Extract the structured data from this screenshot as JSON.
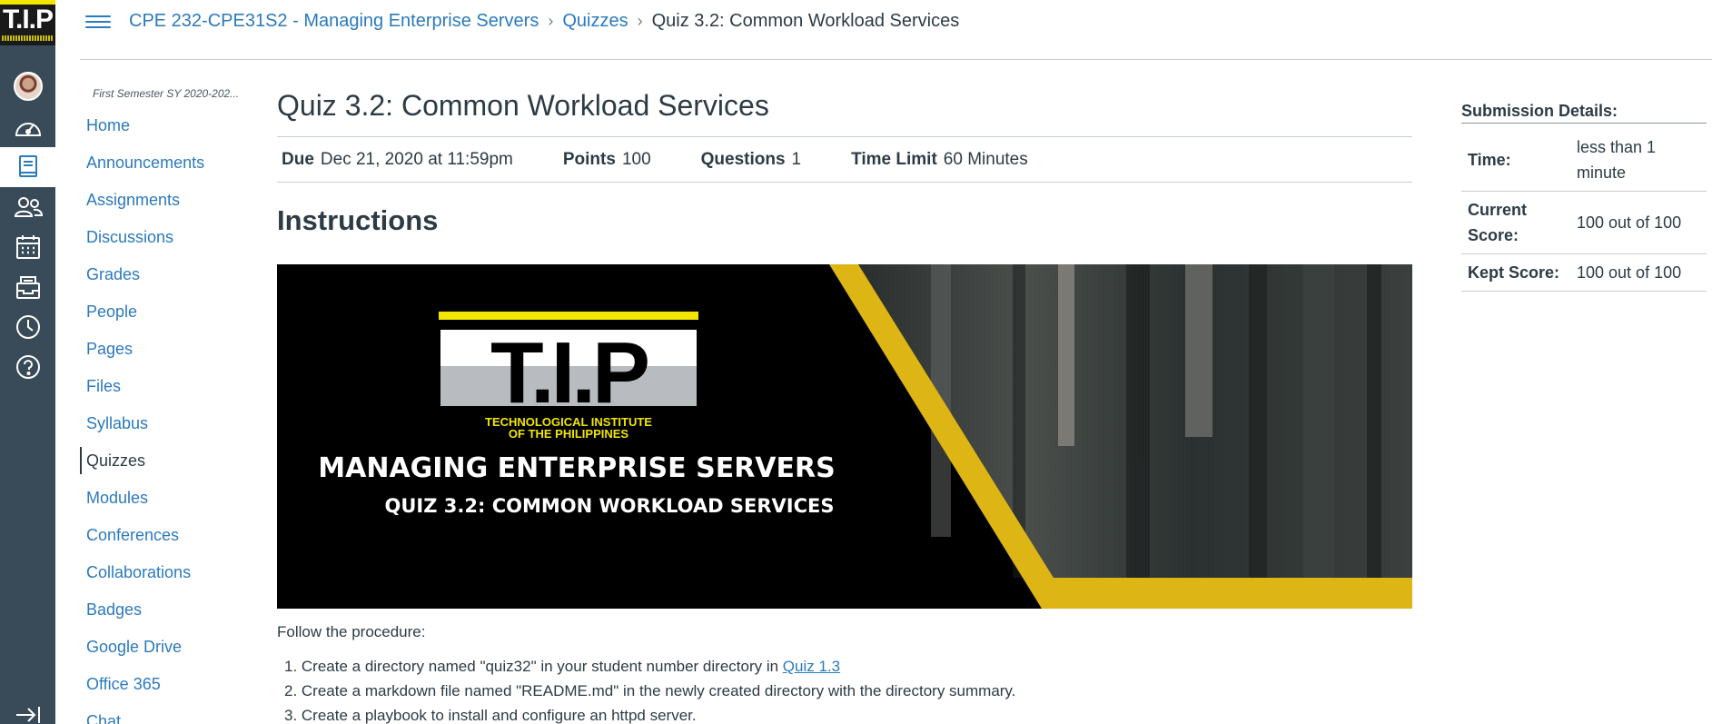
{
  "header": {
    "breadcrumbs": [
      "CPE 232-CPE31S2 - Managing Enterprise Servers",
      "Quizzes",
      "Quiz 3.2: Common Workload Services"
    ]
  },
  "global_nav": {
    "logo_text": "T.I.P",
    "icons": [
      "account-icon",
      "dashboard-icon",
      "courses-icon",
      "groups-icon",
      "calendar-icon",
      "inbox-icon",
      "history-icon",
      "help-icon",
      "collapse-nav-icon"
    ]
  },
  "course_nav": {
    "term": "First Semester SY 2020-202...",
    "items": [
      "Home",
      "Announcements",
      "Assignments",
      "Discussions",
      "Grades",
      "People",
      "Pages",
      "Files",
      "Syllabus",
      "Quizzes",
      "Modules",
      "Conferences",
      "Collaborations",
      "Badges",
      "Google Drive",
      "Office 365",
      "Chat"
    ],
    "active": "Quizzes"
  },
  "quiz": {
    "title": "Quiz 3.2: Common Workload Services",
    "due_label": "Due",
    "due": "Dec 21, 2020 at 11:59pm",
    "points_label": "Points",
    "points": "100",
    "questions_label": "Questions",
    "questions": "1",
    "time_limit_label": "Time Limit",
    "time_limit": "60 Minutes",
    "instructions_heading": "Instructions",
    "banner": {
      "logo_text": "T.I.P",
      "institute_line1": "TECHNOLOGICAL INSTITUTE",
      "institute_line2": "OF THE PHILIPPINES",
      "headline": "MANAGING ENTERPRISE SERVERS",
      "subline": "QUIZ 3.2: COMMON WORKLOAD SERVICES"
    },
    "intro": "Follow the procedure:",
    "steps": [
      {
        "prefix": "1. Create a directory named \"quiz32\" in your student number directory in ",
        "link": "Quiz 1.3"
      },
      {
        "prefix": "2. Create a markdown file named \"README.md\" in the newly created directory with the directory summary.",
        "link": ""
      },
      {
        "prefix": "3. Create a playbook to install and configure an httpd server.",
        "link": ""
      }
    ]
  },
  "submission": {
    "heading": "Submission Details:",
    "rows": [
      {
        "label": "Time:",
        "value": "less than 1 minute"
      },
      {
        "label": "Current Score:",
        "value": "100 out of 100"
      },
      {
        "label": "Kept Score:",
        "value": "100 out of 100"
      }
    ]
  },
  "colors": {
    "link": "#2b7abc",
    "nav_bg": "#394b58",
    "banner_yellow": "#ddb515"
  }
}
